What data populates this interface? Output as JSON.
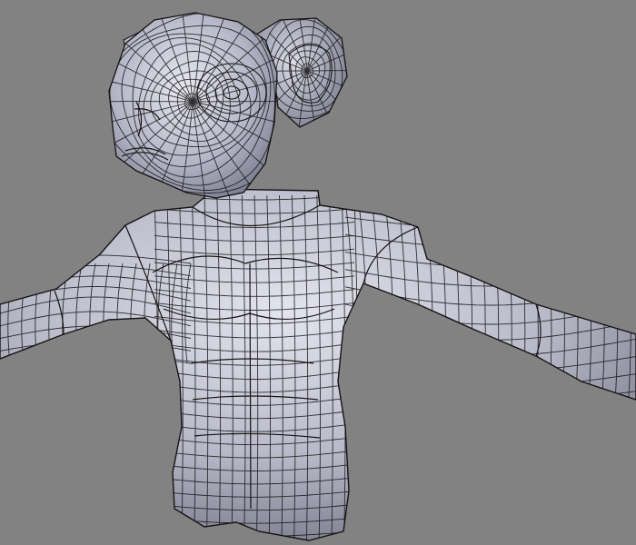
{
  "viewport": {
    "background": "#828282",
    "mesh": {
      "subject": "humanoid-creature-torso-wireframe",
      "shading": "solid-with-wireframe",
      "surface_color": "#b8b8c8",
      "wire_color": "#111111",
      "highlight_color": "#e4e4ef",
      "shadow_color": "#6e6e80"
    }
  }
}
